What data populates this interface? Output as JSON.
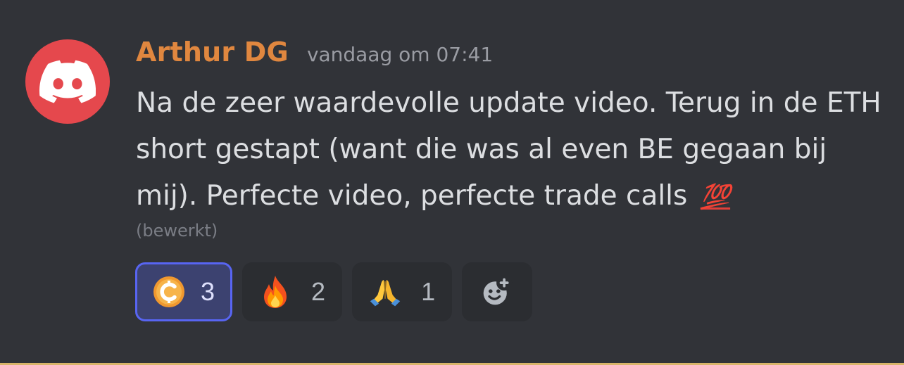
{
  "message": {
    "username": "Arthur DG",
    "timestamp": "vandaag om 07:41",
    "text": "Na de zeer waardevolle update video. Terug in de ETH short gestapt (want die was al even BE gegaan bij mij). Perfecte video, perfecte trade calls",
    "text_emoji": "💯",
    "edited_label": "(bewerkt)"
  },
  "avatar": {
    "icon": "discord-logo-icon",
    "background": "#e5484d"
  },
  "reactions": [
    {
      "icon": "coin-c-icon",
      "count": "3",
      "active": true
    },
    {
      "icon": "fire-emoji-icon",
      "count": "2",
      "active": false
    },
    {
      "icon": "praying-hands-emoji-icon",
      "count": "1",
      "active": false
    }
  ],
  "add_reaction": {
    "icon": "add-reaction-icon"
  },
  "colors": {
    "background": "#313338",
    "username": "#e0873f",
    "active_reaction_border": "#5865f2"
  }
}
